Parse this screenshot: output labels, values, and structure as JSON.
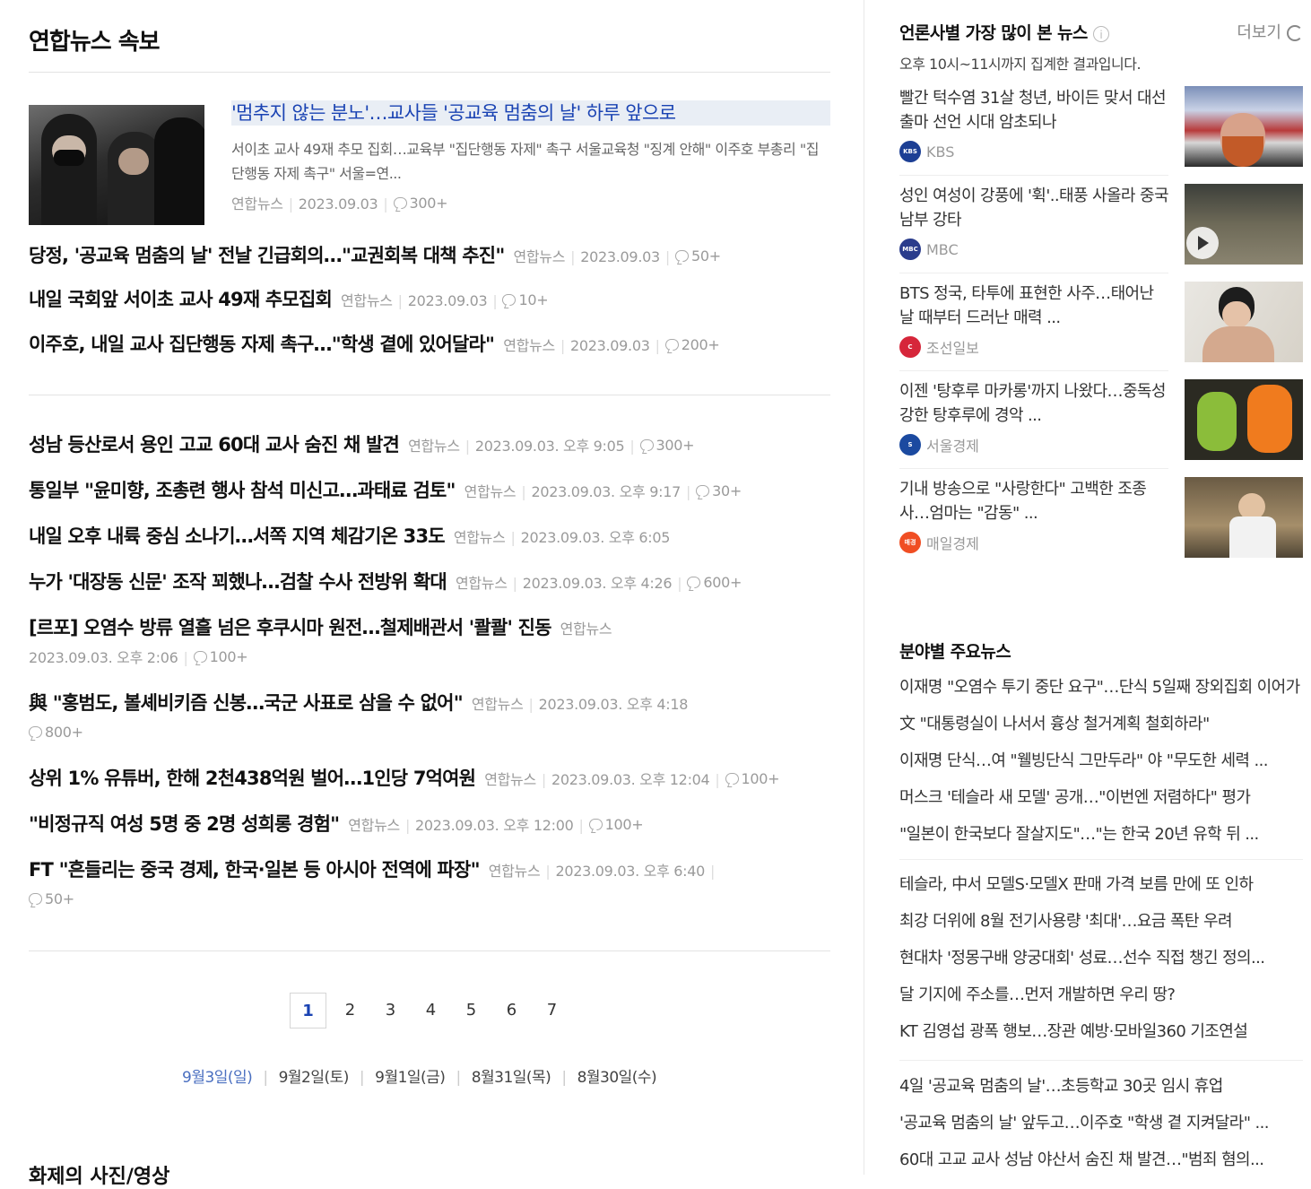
{
  "page_title": "연합뉴스 속보",
  "lead": {
    "title": "'멈추지 않는 분노'…교사들 '공교육 멈춤의 날' 하루 앞으로",
    "desc": "서이초 교사 49재 추모 집회…교육부 \"집단행동 자제\" 촉구 서울교육청 \"징계 안해\" 이주호 부총리 \"집단행동 자제 촉구\" 서울=연...",
    "source": "연합뉴스",
    "date": "2023.09.03",
    "comments": "300+"
  },
  "top_rows": [
    {
      "title": "당정, '공교육 멈춤의 날' 전날 긴급회의…\"교권회복 대책 추진\"",
      "source": "연합뉴스",
      "date": "2023.09.03",
      "comments": "50+"
    },
    {
      "title": "내일 국회앞 서이초 교사 49재 추모집회",
      "source": "연합뉴스",
      "date": "2023.09.03",
      "comments": "10+"
    },
    {
      "title": "이주호, 내일 교사 집단행동 자제 촉구…\"학생 곁에 있어달라\"",
      "source": "연합뉴스",
      "date": "2023.09.03",
      "comments": "200+"
    }
  ],
  "rows": [
    {
      "title": "성남 등산로서 용인 고교 60대 교사 숨진 채 발견",
      "source": "연합뉴스",
      "date": "2023.09.03. 오후 9:05",
      "comments": "300+"
    },
    {
      "title": "통일부 \"윤미향, 조총련 행사 참석 미신고…과태료 검토\"",
      "source": "연합뉴스",
      "date": "2023.09.03. 오후 9:17",
      "comments": "30+"
    },
    {
      "title": "내일 오후 내륙 중심 소나기…서쪽 지역 체감기온 33도",
      "source": "연합뉴스",
      "date": "2023.09.03. 오후 6:05",
      "comments": ""
    },
    {
      "title": "누가 '대장동 신문' 조작 꾀했나…검찰 수사 전방위 확대",
      "source": "연합뉴스",
      "date": "2023.09.03. 오후 4:26",
      "comments": "600+"
    },
    {
      "title": "[르포] 오염수 방류 열흘 넘은 후쿠시마 원전…철제배관서 '콸콸' 진동",
      "source": "연합뉴스",
      "date": "2023.09.03. 오후 2:06",
      "comments": "100+"
    },
    {
      "title": "與 \"홍범도, 볼셰비키즘 신봉…국군 사표로 삼을 수 없어\"",
      "source": "연합뉴스",
      "date": "2023.09.03. 오후 4:18",
      "comments": "800+"
    },
    {
      "title": "상위 1% 유튜버, 한해 2천438억원 벌어…1인당 7억여원",
      "source": "연합뉴스",
      "date": "2023.09.03. 오후 12:04",
      "comments": "100+"
    },
    {
      "title": "\"비정규직 여성 5명 중 2명 성희롱 경험\"",
      "source": "연합뉴스",
      "date": "2023.09.03. 오후 12:00",
      "comments": "100+"
    },
    {
      "title": "FT \"흔들리는 중국 경제, 한국·일본 등 아시아 전역에 파장\"",
      "source": "연합뉴스",
      "date": "2023.09.03. 오후 6:40",
      "comments": "50+"
    }
  ],
  "pagination": [
    "1",
    "2",
    "3",
    "4",
    "5",
    "6",
    "7"
  ],
  "dates": [
    "9월3일(일)",
    "9월2일(토)",
    "9월1일(금)",
    "8월31일(목)",
    "8월30일(수)"
  ],
  "photo_heading": "화제의 사진/영상",
  "right": {
    "most_viewed_title": "언론사별 가장 많이 본 뉴스",
    "more_label": "더보기",
    "most_viewed_sub": "오후 10시~11시까지 집계한 결과입니다.",
    "cards": [
      {
        "text": "빨간 턱수염 31살 청년, 바이든 맞서 대선 출마 선언 시대 암초되나",
        "source": "KBS",
        "logo_text": "KBS",
        "logo_color": "#1c3f94"
      },
      {
        "text": "성인 여성이 강풍에 '휙'..태풍 사올라 중국 남부 강타",
        "source": "MBC",
        "logo_text": "MBC",
        "logo_color": "#2a3c8c"
      },
      {
        "text": "BTS 정국, 타투에 표현한 사주…태어난 날 때부터 드러난 매력 ...",
        "source": "조선일보",
        "logo_text": "C",
        "logo_color": "#d6263a"
      },
      {
        "text": "이젠 '탕후루 마카롱'까지 나왔다…중독성 강한 탕후루에 경악 ...",
        "source": "서울경제",
        "logo_text": "S",
        "logo_color": "#1b4aa0"
      },
      {
        "text": "기내 방송으로 \"사랑한다\" 고백한 조종사…엄마는 \"감동\" ...",
        "source": "매일경제",
        "logo_text": "매경",
        "logo_color": "#f04e23"
      }
    ],
    "section_news_title": "분야별 주요뉴스",
    "section_news": [
      "이재명 \"오염수 투기 중단 요구\"…단식 5일째 장외집회 이어가",
      "文 \"대통령실이 나서서 흉상 철거계획 철회하라\"",
      "이재명 단식…여 \"웰빙단식 그만두라\" 야 \"무도한 세력 ...",
      "머스크 '테슬라 새 모델' 공개…\"이번엔 저렴하다\" 평가",
      "\"일본이 한국보다 잘살지도\"…\"는 한국 20년 유학 뒤 ...",
      "테슬라, 中서 모델S·모델X 판매 가격 보름 만에 또 인하",
      "최강 더위에 8월 전기사용량 '최대'…요금 폭탄 우려",
      "현대차 '정몽구배 양궁대회' 성료…선수 직접 챙긴 정의...",
      "달 기지에 주소를…먼저 개발하면 우리 땅?",
      "KT 김영섭 광폭 행보…장관 예방·모바일360 기조연설",
      "4일 '공교육 멈춤의 날'…초등학교 30곳 임시 휴업",
      "'공교육 멈춤의 날' 앞두고…이주호 \"학생 곁 지켜달라\" ...",
      "60대 고교 교사 성남 야산서 숨진 채 발견…\"범죄 혐의..."
    ]
  }
}
